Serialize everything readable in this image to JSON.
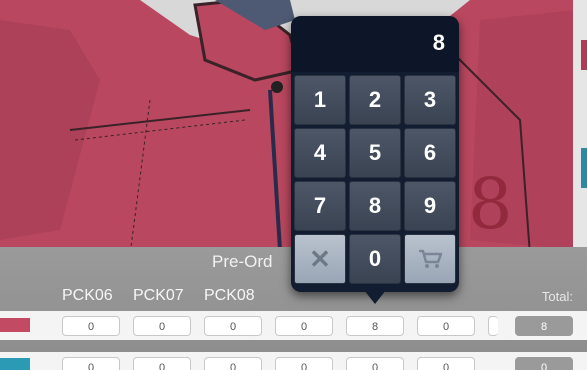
{
  "keypad": {
    "display_value": "8",
    "keys": [
      "1",
      "2",
      "3",
      "4",
      "5",
      "6",
      "7",
      "8",
      "9"
    ],
    "clear_symbol": "✕",
    "zero": "0",
    "cart_icon": "cart-icon"
  },
  "preorder": {
    "title": "Pre-Ord",
    "columns": [
      "PCK06",
      "PCK07",
      "PCK08"
    ],
    "total_label": "Total:",
    "rows": [
      {
        "values": [
          "0",
          "0",
          "0",
          "0",
          "8",
          "0"
        ],
        "total": "8",
        "swatch": "#c24a63"
      },
      {
        "values": [
          "0",
          "0",
          "0",
          "0",
          "0",
          "0"
        ],
        "total": "0",
        "swatch": "#2a9ab5"
      }
    ]
  },
  "colors": {
    "garment": "#b9475f",
    "keypad_bg": "#121d31",
    "accent_key": "#a9b4c4"
  }
}
